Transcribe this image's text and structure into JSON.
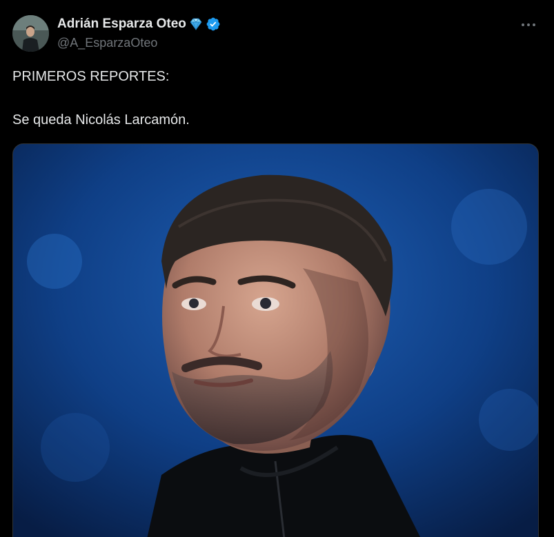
{
  "author": {
    "display_name": "Adrián Esparza Oteo",
    "handle": "@A_EsparzaOteo",
    "badges": [
      "gem-stone-icon",
      "verified-badge-icon"
    ]
  },
  "actions": {
    "more_icon": "more-horizontal-icon"
  },
  "tweet": {
    "lines": [
      "PRIMEROS REPORTES:",
      "Se queda Nicolás Larcamón."
    ]
  },
  "media": {
    "type": "photo",
    "subject_icon": "person-portrait-photo"
  },
  "colors": {
    "background": "#000000",
    "text_primary": "#e7e9ea",
    "text_secondary": "#71767b",
    "verified": "#1d9bf0",
    "photo_bg": "#0e3f86"
  }
}
